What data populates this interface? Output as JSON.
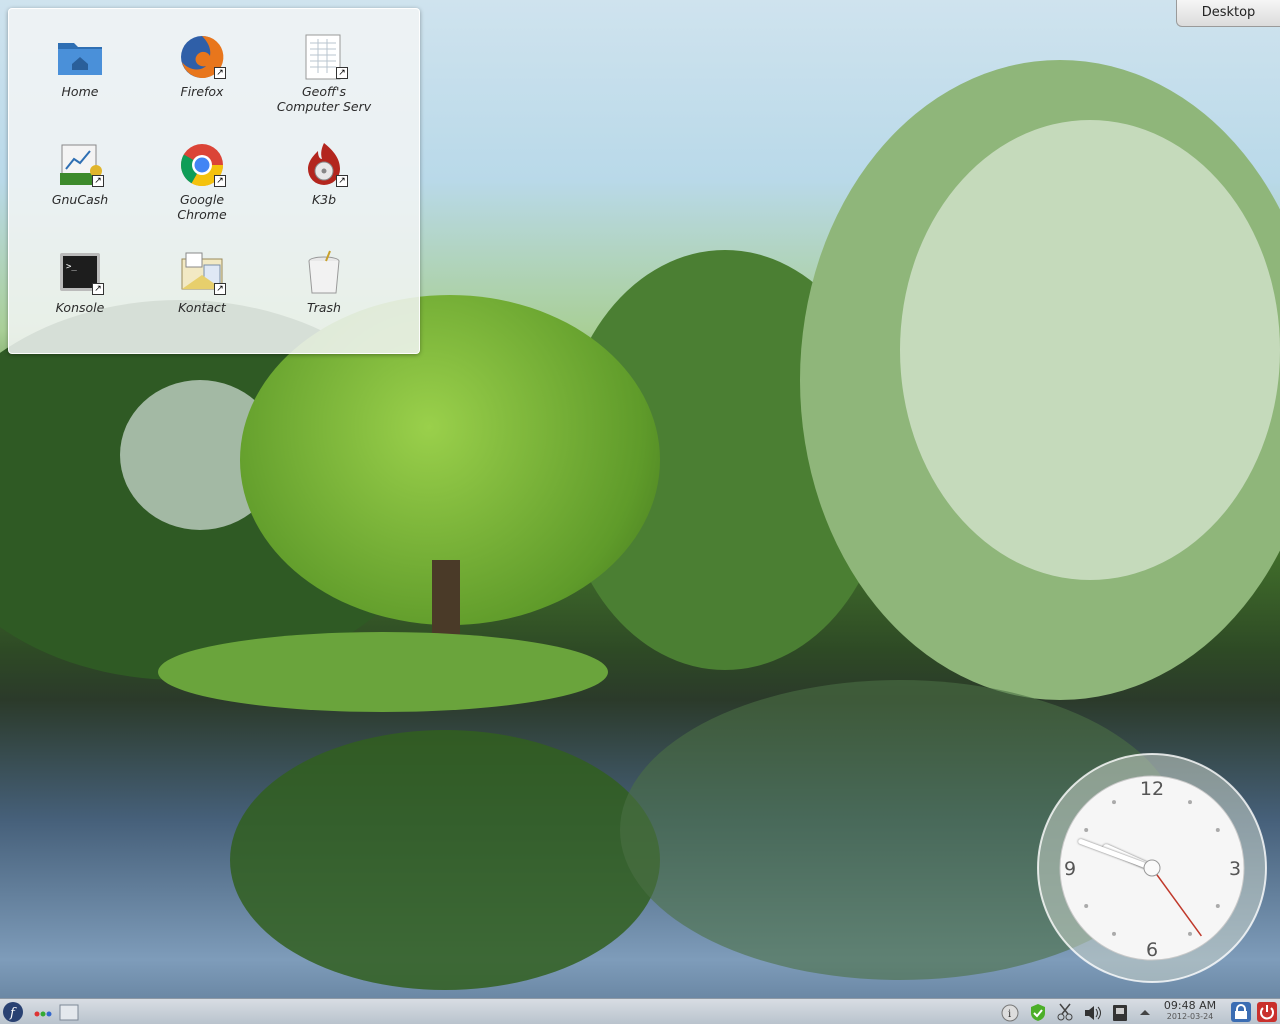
{
  "desktop": {
    "toolbox_label": "Desktop"
  },
  "folder_view": {
    "items": [
      {
        "label": "Home",
        "icon": "home-folder-icon"
      },
      {
        "label": "Firefox",
        "icon": "firefox-icon"
      },
      {
        "label": "Geoff's Computer Serv",
        "icon": "document-link-icon"
      },
      {
        "label": "GnuCash",
        "icon": "gnucash-icon"
      },
      {
        "label": "Google Chrome",
        "icon": "chrome-icon"
      },
      {
        "label": "K3b",
        "icon": "k3b-icon"
      },
      {
        "label": "Konsole",
        "icon": "konsole-icon"
      },
      {
        "label": "Kontact",
        "icon": "kontact-icon"
      },
      {
        "label": "Trash",
        "icon": "trash-icon"
      }
    ],
    "labels": {
      "home": "Home",
      "firefox": "Firefox",
      "geoffs_line1": "Geoff's",
      "geoffs_line2": "Computer Serv",
      "gnucash": "GnuCash",
      "chrome_line1": "Google",
      "chrome_line2": "Chrome",
      "k3b": "K3b",
      "konsole": "Konsole",
      "kontact": "Kontact",
      "trash": "Trash"
    }
  },
  "clock_widget": {
    "numerals": {
      "twelve": "12",
      "three": "3",
      "six": "6",
      "nine": "9"
    },
    "time": {
      "hour": 9,
      "minute": 48,
      "second": 24
    }
  },
  "taskbar": {
    "launcher_icon": "fedora-icon",
    "activity_icon": "activity-dots-icon",
    "pager_icon": "pager-icon",
    "tray_icons": [
      "info-icon",
      "update-shield-icon",
      "scissors-icon",
      "volume-icon",
      "device-notifier-icon",
      "expand-tray-icon"
    ],
    "clock_time": "09:48 AM",
    "clock_date": "2012-03-24",
    "right_icons": [
      "lock-screen-icon",
      "power-icon"
    ]
  }
}
